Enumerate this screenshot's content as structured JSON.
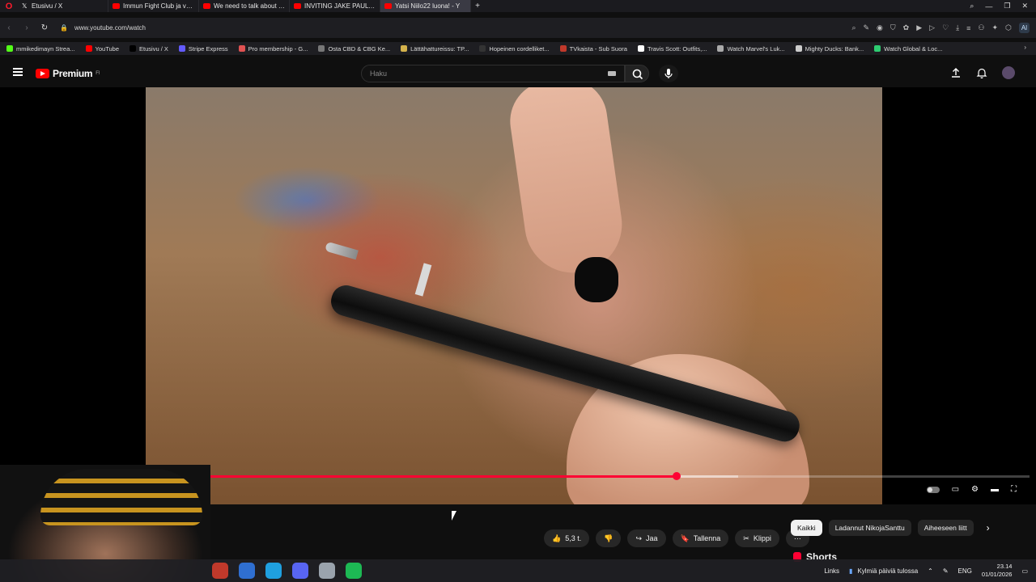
{
  "browser": {
    "tabs": [
      {
        "title": "Etusivu / X",
        "icon": "x"
      },
      {
        "title": "Immun Fight Club ja valm",
        "icon": "yt"
      },
      {
        "title": "We need to talk about thi",
        "icon": "yt"
      },
      {
        "title": "INVITING JAKE PAUL TO TI",
        "icon": "yt"
      },
      {
        "title": "Yatsi Niilo22 luona! - Y",
        "icon": "yt",
        "active": true
      }
    ],
    "new_tab": "+",
    "url": "www.youtube.com/watch",
    "ai_label": "Al",
    "bookmarks": [
      {
        "label": "mmikedimayn Strea...",
        "color": "#53fc18"
      },
      {
        "label": "YouTube",
        "color": "#ff0000"
      },
      {
        "label": "Etusivu / X",
        "color": "#000000"
      },
      {
        "label": "Stripe Express",
        "color": "#635bff"
      },
      {
        "label": "Pro membership - G...",
        "color": "#e05252"
      },
      {
        "label": "Osta CBD & CBG Ke...",
        "color": "#777777"
      },
      {
        "label": "Lättähattureissu: TP...",
        "color": "#d4b24c"
      },
      {
        "label": "Hopeinen cordelliket...",
        "color": "#333333"
      },
      {
        "label": "TVkaista - Sub Suora",
        "color": "#c0392b"
      },
      {
        "label": "Travis Scott: Outfits,...",
        "color": "#ffffff"
      },
      {
        "label": "Watch Marvel's Luk...",
        "color": "#aaaaaa"
      },
      {
        "label": "Mighty Ducks: Bank...",
        "color": "#cccccc"
      },
      {
        "label": "Watch Global & Loc...",
        "color": "#2ecc71"
      }
    ]
  },
  "youtube": {
    "brand": "Premium",
    "brand_sup": "FI",
    "search_placeholder": "Haku",
    "accent": "#ff0033",
    "player": {
      "progress": 0.655,
      "buffered": 0.715,
      "pause_glyph": "❚❚"
    },
    "actions": [
      {
        "name": "like",
        "glyph": "👍",
        "label": "5,3 t."
      },
      {
        "name": "dislike",
        "glyph": "👎",
        "label": ""
      },
      {
        "name": "share",
        "glyph": "↪",
        "label": "Jaa"
      },
      {
        "name": "save",
        "glyph": "🔖",
        "label": "Tallenna"
      },
      {
        "name": "clip",
        "glyph": "✂",
        "label": "Klippi"
      },
      {
        "name": "more",
        "glyph": "⋯",
        "label": ""
      }
    ],
    "chips": [
      "Kaikki",
      "Ladannut NikojaSanttu",
      "Aiheeseen liitt"
    ],
    "shorts_label": "Shorts"
  },
  "taskbar": {
    "apps": [
      "#c0392b",
      "#2f6fd1",
      "#1fa0e0",
      "#5865f2",
      "#9aa3ad",
      "#1db954"
    ],
    "links_label": "Links",
    "weather": "Kylmiä päiviä tulossa",
    "lang": "ENG",
    "time": "23.14",
    "date": "01/01/2026"
  }
}
